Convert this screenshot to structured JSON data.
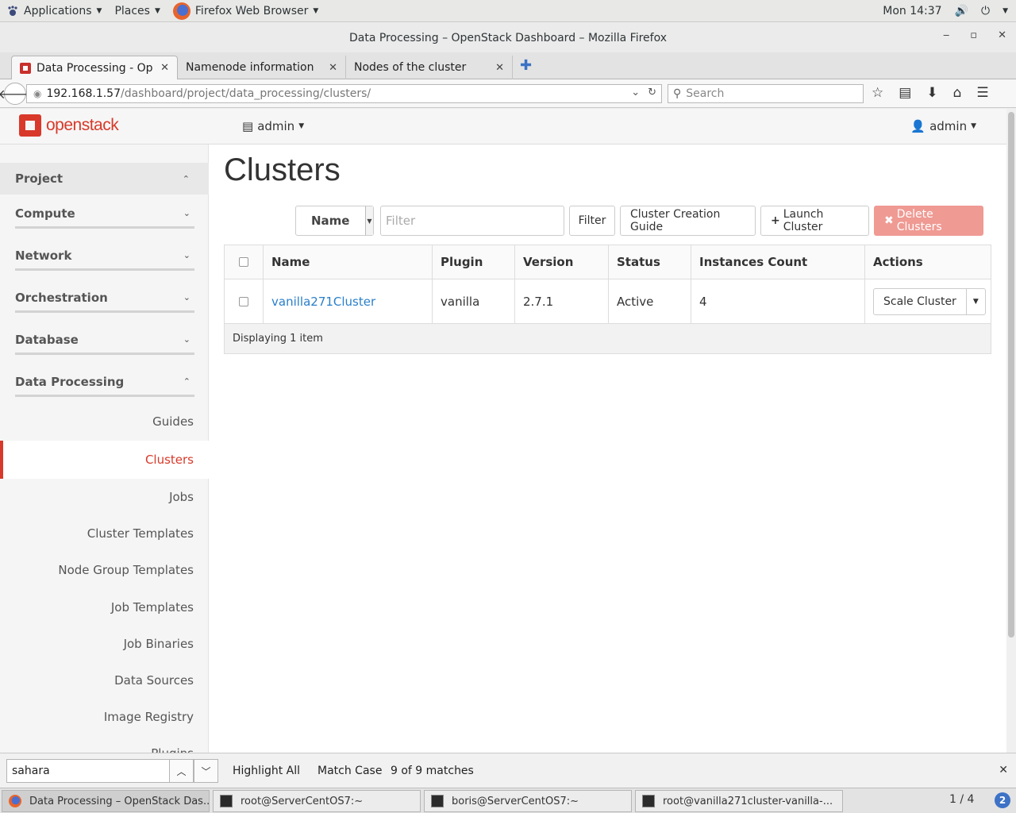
{
  "topbar": {
    "applications": "Applications",
    "places": "Places",
    "browser": "Firefox Web Browser",
    "clock": "Mon 14:37"
  },
  "window": {
    "title": "Data Processing – OpenStack Dashboard – Mozilla Firefox"
  },
  "tabs": [
    {
      "label": "Data Processing - Op..."
    },
    {
      "label": "Namenode information"
    },
    {
      "label": "Nodes of the cluster"
    }
  ],
  "urlbar": {
    "host": "192.168.1.57",
    "path": "/dashboard/project/data_processing/clusters/"
  },
  "searchbar": {
    "placeholder": "Search"
  },
  "header": {
    "logo": "openstack",
    "project_menu": "admin",
    "user_menu": "admin"
  },
  "sidebar": {
    "project": "Project",
    "sections": [
      "Compute",
      "Network",
      "Orchestration",
      "Database",
      "Data Processing"
    ],
    "links": [
      "Guides",
      "Clusters",
      "Jobs",
      "Cluster Templates",
      "Node Group Templates",
      "Job Templates",
      "Job Binaries",
      "Data Sources",
      "Image Registry",
      "Plugins"
    ]
  },
  "main": {
    "title": "Clusters",
    "filter_field": "Name",
    "filter_placeholder": "Filter",
    "filter_button": "Filter",
    "guide_button": "Cluster Creation Guide",
    "launch_button": "Launch Cluster",
    "delete_button": "Delete Clusters"
  },
  "table": {
    "headers": [
      "Name",
      "Plugin",
      "Version",
      "Status",
      "Instances Count",
      "Actions"
    ],
    "rows": [
      {
        "name": "vanilla271Cluster",
        "plugin": "vanilla",
        "version": "2.7.1",
        "status": "Active",
        "instances": "4",
        "action": "Scale Cluster"
      }
    ],
    "footer": "Displaying 1 item"
  },
  "findbar": {
    "query": "sahara",
    "highlight_all": "Highlight All",
    "match_case": "Match Case",
    "matches": "9 of 9 matches"
  },
  "taskbar": {
    "tasks": [
      "Data Processing – OpenStack Das...",
      "root@ServerCentOS7:~",
      "boris@ServerCentOS7:~",
      "root@vanilla271cluster-vanilla-..."
    ],
    "workspace": "1 / 4",
    "badge": "2"
  },
  "colors": {
    "brand_red": "#d8392a",
    "link_blue": "#2a7fc9",
    "danger_button": "#ef9a93"
  }
}
